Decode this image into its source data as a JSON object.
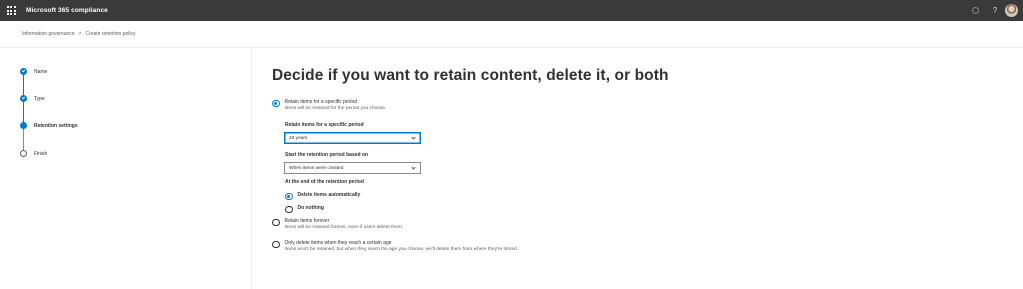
{
  "header": {
    "app_title": "Microsoft 365 compliance",
    "help_symbol": "?",
    "icons": [
      "waffle-icon",
      "settings-icon",
      "help-icon",
      "avatar"
    ]
  },
  "breadcrumb": {
    "items": [
      "Information governance",
      "Create retention policy"
    ],
    "separator": ">"
  },
  "steps": [
    {
      "label": "Name",
      "status": "complete"
    },
    {
      "label": "Type",
      "status": "complete"
    },
    {
      "label": "Retention settings",
      "status": "current"
    },
    {
      "label": "Finish",
      "status": "not-started"
    }
  ],
  "main": {
    "title": "Decide if you want to retain content, delete it, or both",
    "options": [
      {
        "label": "Retain items for a specific period",
        "description": "Items will be retained for the period you choose.",
        "selected": true
      },
      {
        "label": "Retain items forever",
        "description": "Items will be retained forever, even if users delete them.",
        "selected": false
      },
      {
        "label": "Only delete items when they reach a certain age",
        "description": "Items won't be retained, but when they reach the age you choose, we'll delete them from where they're stored.",
        "selected": false
      }
    ],
    "period_field": {
      "label": "Retain items for a specific period",
      "value": "10 years"
    },
    "start_field": {
      "label": "Start the retention period based on",
      "value": "When items were created"
    },
    "end_section": {
      "label": "At the end of the retention period",
      "options": [
        {
          "label": "Delete items automatically",
          "selected": true
        },
        {
          "label": "Do nothing",
          "selected": false
        }
      ]
    }
  },
  "colors": {
    "accent": "#0078d4",
    "topbar": "#3a3a3a"
  }
}
